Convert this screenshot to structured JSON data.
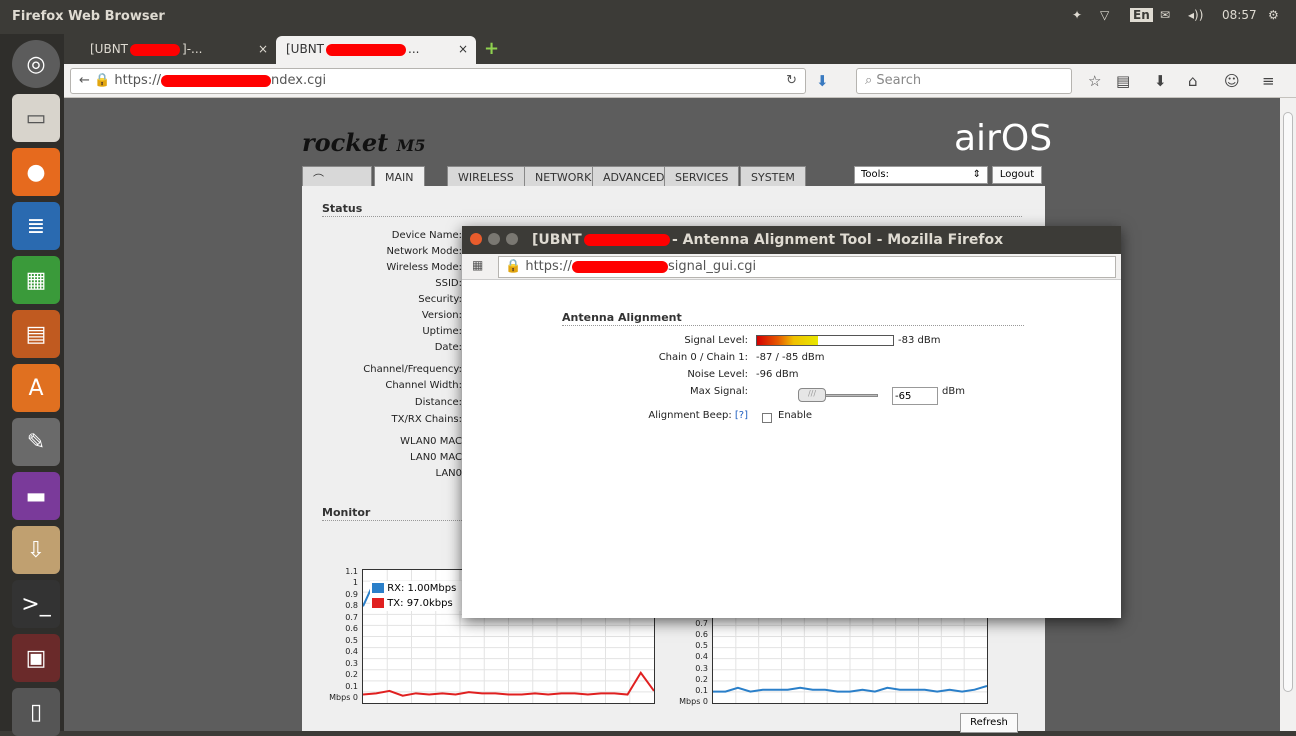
{
  "system": {
    "title": "Firefox Web Browser",
    "lang": "En",
    "time": "08:57"
  },
  "tabs": [
    {
      "label": "[UBNT",
      "suffix": "]-...",
      "close": "×"
    },
    {
      "label": "[UBNT",
      "suffix": "...",
      "close": "×"
    }
  ],
  "nav": {
    "url_prefix": "https://",
    "url_suffix": "ndex.cgi",
    "search_placeholder": "Search"
  },
  "air": {
    "brand": "rocket",
    "model": "M5",
    "logo": "airOS",
    "tabs": [
      "MAIN",
      "WIRELESS",
      "NETWORK",
      "ADVANCED",
      "SERVICES",
      "SYSTEM"
    ],
    "tools_label": "Tools:",
    "logout": "Logout",
    "status_title": "Status",
    "status_labels": [
      "Device Name:",
      "Network Mode:",
      "Wireless Mode:",
      "SSID:",
      "Security:",
      "Version:",
      "Uptime:",
      "Date:",
      "Channel/Frequency:",
      "Channel Width:",
      "Distance:",
      "TX/RX Chains:",
      "WLAN0 MAC",
      "LAN0 MAC",
      "LAN0"
    ],
    "monitor_title": "Monitor",
    "legend": [
      {
        "name": "RX: 1.00Mbps",
        "color": "#2a7fc9"
      },
      {
        "name": "TX: 97.0kbps",
        "color": "#e02020"
      }
    ],
    "y_ticks_left": [
      "1.1",
      "1",
      "0.9",
      "0.8",
      "0.7",
      "0.6",
      "0.5",
      "0.4",
      "0.3",
      "0.2",
      "0.1",
      "Mbps 0"
    ],
    "y_ticks_right": [
      "0.7",
      "0.6",
      "0.5",
      "0.4",
      "0.3",
      "0.2",
      "0.1",
      "Mbps 0"
    ],
    "refresh": "Refresh"
  },
  "popup": {
    "title_prefix": "[UBNT",
    "title_suffix": "- Antenna Alignment Tool - Mozilla Firefox",
    "url_prefix": "https://",
    "url_suffix": "signal_gui.cgi",
    "section": "Antenna Alignment",
    "signal_label": "Signal Level:",
    "signal_value": "-83 dBm",
    "signal_fraction": 0.45,
    "chain_label": "Chain 0 / Chain 1:",
    "chain_value": "-87 / -85 dBm",
    "noise_label": "Noise Level:",
    "noise_value": "-96 dBm",
    "max_label": "Max Signal:",
    "max_value": "-65",
    "max_unit": "dBm",
    "beep_label": "Alignment Beep:",
    "beep_help": "[?]",
    "beep_enable": "Enable"
  },
  "chart_data": [
    {
      "type": "line",
      "title": "",
      "xlabel": "",
      "ylabel": "Mbps",
      "ylim": [
        0,
        1.1
      ],
      "series": [
        {
          "name": "RX: 1.00Mbps",
          "values": [
            0.8,
            1.0,
            0.95,
            0.85,
            1.0,
            1.0,
            1.0,
            1.0,
            1.0,
            1.0
          ]
        },
        {
          "name": "TX: 97.0kbps",
          "values": [
            0.07,
            0.08,
            0.1,
            0.06,
            0.08,
            0.07,
            0.08,
            0.07,
            0.09,
            0.08,
            0.08,
            0.07,
            0.07,
            0.08,
            0.07,
            0.08,
            0.08,
            0.07,
            0.08,
            0.08,
            0.07,
            0.25,
            0.1
          ]
        }
      ]
    },
    {
      "type": "line",
      "title": "",
      "xlabel": "",
      "ylabel": "Mbps",
      "ylim": [
        0,
        0.7
      ],
      "series": [
        {
          "values": [
            0.06,
            0.06,
            0.08,
            0.06,
            0.07,
            0.07,
            0.07,
            0.08,
            0.07,
            0.07,
            0.06,
            0.06,
            0.07,
            0.06,
            0.08,
            0.07,
            0.07,
            0.07,
            0.06,
            0.07,
            0.06,
            0.07,
            0.09
          ]
        }
      ]
    }
  ]
}
